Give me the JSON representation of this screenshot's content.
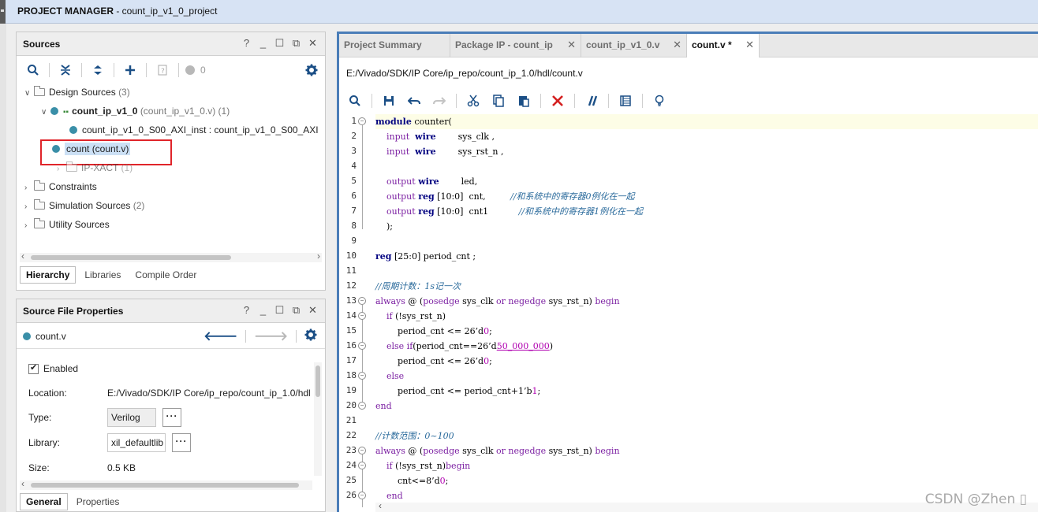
{
  "window": {
    "title_bold": "PROJECT MANAGER",
    "title_rest": " - count_ip_v1_0_project"
  },
  "sources": {
    "title": "Sources",
    "badge_count": "0",
    "tree": {
      "design_sources": "Design Sources",
      "design_sources_count": "(3)",
      "top_module": "count_ip_v1_0",
      "top_module_file": "(count_ip_v1_0.v) (1)",
      "instance": "count_ip_v1_0_S00_AXI_inst : count_ip_v1_0_S00_AXI",
      "count_file": "count (count.v)",
      "ipxact": "IP-XACT",
      "ipxact_count": "(1)",
      "constraints": "Constraints",
      "simulation": "Simulation Sources",
      "simulation_count": "(2)",
      "utility": "Utility Sources"
    },
    "tabs": [
      "Hierarchy",
      "Libraries",
      "Compile Order"
    ]
  },
  "properties": {
    "title": "Source File Properties",
    "file": "count.v",
    "enabled_label": "Enabled",
    "location_label": "Location:",
    "location_value": "E:/Vivado/SDK/IP Core/ip_repo/count_ip_1.0/hdl",
    "type_label": "Type:",
    "type_value": "Verilog",
    "library_label": "Library:",
    "library_value": "xil_defaultlib",
    "size_label": "Size:",
    "size_value": "0.5 KB",
    "dots": "···",
    "tabs": [
      "General",
      "Properties"
    ]
  },
  "editor": {
    "tabs": [
      "Project Summary",
      "Package IP - count_ip",
      "count_ip_v1_0.v",
      "count.v *"
    ],
    "path": "E:/Vivado/SDK/IP Core/ip_repo/count_ip_1.0/hdl/count.v",
    "line_numbers": [
      "1",
      "2",
      "3",
      "4",
      "5",
      "6",
      "7",
      "8",
      "9",
      "10",
      "11",
      "12",
      "13",
      "14",
      "15",
      "16",
      "17",
      "18",
      "19",
      "20",
      "21",
      "22",
      "23",
      "24",
      "25",
      "26"
    ]
  },
  "code": {
    "l1_kw": "module",
    "l1_rest": " counter(",
    "l2_a": "input",
    "l2_b": "wire",
    "l2_c": "sys_clk ,",
    "l3_a": "input",
    "l3_b": "wire",
    "l3_c": "sys_rst_n ,",
    "l5_a": "output",
    "l5_b": "wire",
    "l5_c": "led,",
    "l6_a": "output",
    "l6_b": "reg",
    "l6_c": " [10:0]  cnt,",
    "l6_d": "//和系统中的寄存器0例化在一起",
    "l7_a": "output",
    "l7_b": "reg",
    "l7_c": " [10:0]  cnt1",
    "l7_d": "//和系统中的寄存器1例化在一起",
    "l8": ");",
    "l10_a": "reg",
    "l10_b": " [25:0] period_cnt ;",
    "l12": "//周期计数：1s记一次",
    "l13_a": "always",
    "l13_b": " @ (",
    "l13_c": "posedge",
    "l13_d": " sys_clk ",
    "l13_e": "or",
    "l13_f": " ",
    "l13_g": "negedge",
    "l13_h": " sys_rst_n) ",
    "l13_i": "begin",
    "l14_a": "if",
    "l14_b": " (!sys_rst_n)",
    "l15_a": "period_cnt <= 26’d",
    "l15_b": "0",
    "l15_c": ";",
    "l16_a": "else if",
    "l16_b": "(period_cnt==26’d",
    "l16_c": "50_000_000",
    "l16_d": ")",
    "l17_a": "period_cnt <= 26’d",
    "l17_b": "0",
    "l17_c": ";",
    "l18": "else",
    "l19_a": "period_cnt <= period_cnt+1’b",
    "l19_b": "1",
    "l19_c": ";",
    "l20": "end",
    "l22": "//计数范围：0~100",
    "l23_a": "always",
    "l23_b": " @ (",
    "l23_c": "posedge",
    "l23_d": " sys_clk ",
    "l23_e": "or",
    "l23_f": " ",
    "l23_g": "negedge",
    "l23_h": " sys_rst_n) ",
    "l23_i": "begin",
    "l24_a": "if",
    "l24_b": " (!sys_rst_n)",
    "l24_c": "begin",
    "l25_a": "cnt<=8’d",
    "l25_b": "0",
    "l25_c": ";",
    "l26": "end"
  },
  "watermark": "CSDN @Zhen ▯"
}
